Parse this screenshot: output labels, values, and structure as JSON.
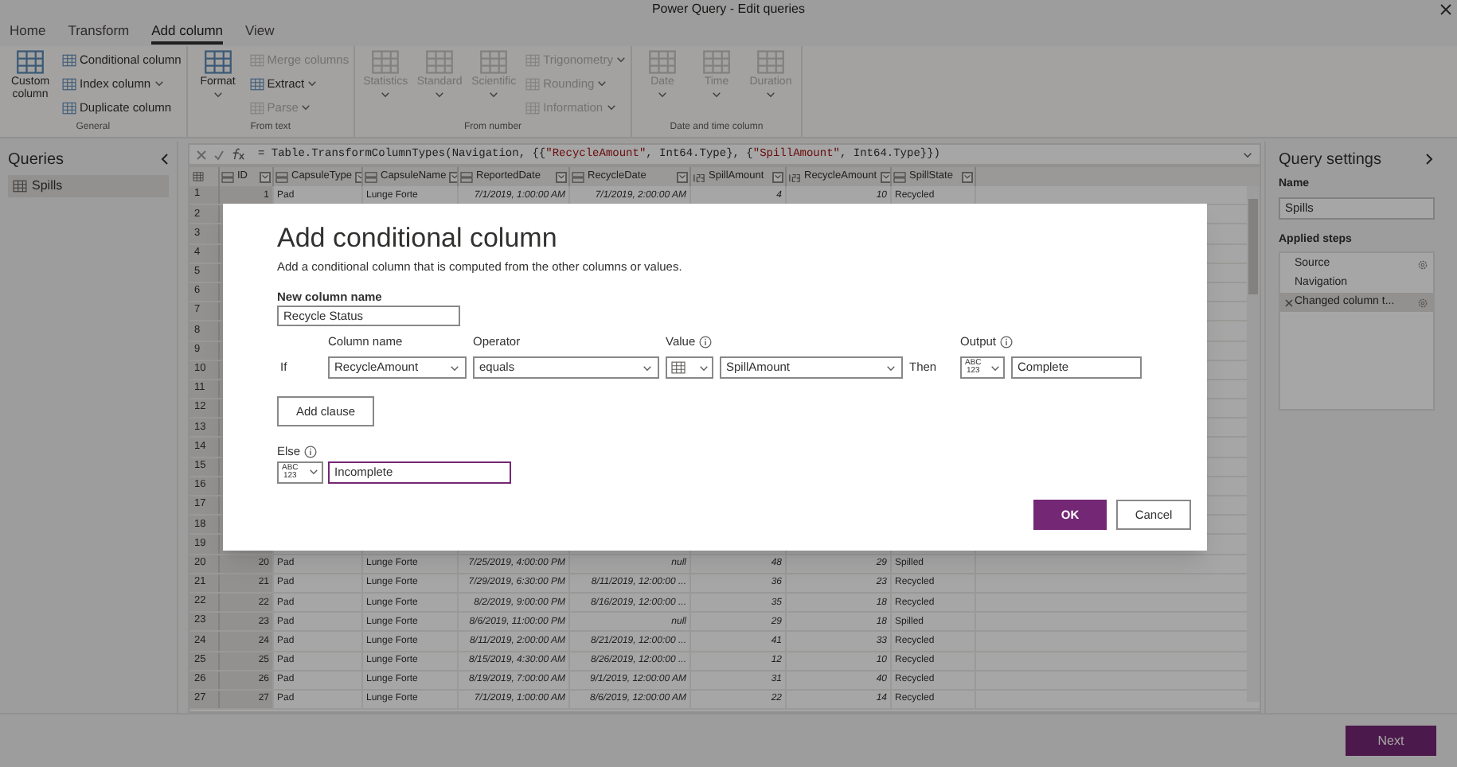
{
  "window": {
    "title": "Power Query - Edit queries"
  },
  "tabs": [
    {
      "label": "Home",
      "selected": false
    },
    {
      "label": "Transform",
      "selected": false
    },
    {
      "label": "Add column",
      "selected": true
    },
    {
      "label": "View",
      "selected": false
    }
  ],
  "ribbon": [
    {
      "label": "General",
      "large": [
        {
          "label": "Custom column",
          "disabled": false,
          "menu": false
        }
      ],
      "small": [
        {
          "label": "Conditional column",
          "disabled": false,
          "menu": false
        },
        {
          "label": "Index column",
          "disabled": false,
          "menu": true
        },
        {
          "label": "Duplicate column",
          "disabled": false,
          "menu": false
        }
      ]
    },
    {
      "label": "From text",
      "large": [
        {
          "label": "Format",
          "disabled": false,
          "menu": true
        }
      ],
      "small": [
        {
          "label": "Merge columns",
          "disabled": true,
          "menu": false
        },
        {
          "label": "Extract",
          "disabled": false,
          "menu": true
        },
        {
          "label": "Parse",
          "disabled": true,
          "menu": true
        }
      ]
    },
    {
      "label": "From number",
      "large": [
        {
          "label": "Statistics",
          "disabled": true,
          "menu": true
        },
        {
          "label": "Standard",
          "disabled": true,
          "menu": true
        },
        {
          "label": "Scientific",
          "disabled": true,
          "menu": true
        }
      ],
      "small": [
        {
          "label": "Trigonometry",
          "disabled": true,
          "menu": true
        },
        {
          "label": "Rounding",
          "disabled": true,
          "menu": true
        },
        {
          "label": "Information",
          "disabled": true,
          "menu": true
        }
      ]
    },
    {
      "label": "Date and time column",
      "large": [
        {
          "label": "Date",
          "disabled": true,
          "menu": true
        },
        {
          "label": "Time",
          "disabled": true,
          "menu": true
        },
        {
          "label": "Duration",
          "disabled": true,
          "menu": true
        }
      ]
    }
  ],
  "queries": {
    "title": "Queries",
    "items": [
      {
        "label": "Spills",
        "selected": true
      }
    ]
  },
  "formula": [
    {
      "kind": "code",
      "text": "= Table.TransformColumnTypes(Navigation, {{"
    },
    {
      "kind": "string",
      "text": "\"RecycleAmount\""
    },
    {
      "kind": "code",
      "text": ", Int64.Type}, {"
    },
    {
      "kind": "string",
      "text": "\"SpillAmount\""
    },
    {
      "kind": "code",
      "text": ", Int64.Type}})"
    }
  ],
  "table": {
    "columns": [
      {
        "label": "ID",
        "kind": "text"
      },
      {
        "label": "CapsuleType",
        "kind": "text"
      },
      {
        "label": "CapsuleName",
        "kind": "text"
      },
      {
        "label": "ReportedDate",
        "kind": "text"
      },
      {
        "label": "RecycleDate",
        "kind": "text"
      },
      {
        "label": "SpillAmount",
        "kind": "number"
      },
      {
        "label": "RecycleAmount",
        "kind": "number"
      },
      {
        "label": "SpillState",
        "kind": "text"
      }
    ],
    "rows": [
      {
        "number": "1",
        "cells": [
          "1",
          "Pad",
          "Lunge Forte",
          "7/1/2019, 1:00:00 AM",
          "7/1/2019, 2:00:00 AM",
          "4",
          "10",
          "Recycled"
        ]
      },
      {
        "number": "2"
      },
      {
        "number": "3"
      },
      {
        "number": "4"
      },
      {
        "number": "5"
      },
      {
        "number": "6"
      },
      {
        "number": "7"
      },
      {
        "number": "8"
      },
      {
        "number": "9"
      },
      {
        "number": "10"
      },
      {
        "number": "11"
      },
      {
        "number": "12"
      },
      {
        "number": "13"
      },
      {
        "number": "14"
      },
      {
        "number": "15"
      },
      {
        "number": "16"
      },
      {
        "number": "17"
      },
      {
        "number": "18"
      },
      {
        "number": "19"
      },
      {
        "number": "20",
        "cells": [
          "20",
          "Pad",
          "Lunge Forte",
          "7/25/2019, 4:00:00 PM",
          "null",
          "48",
          "29",
          "Spilled"
        ]
      },
      {
        "number": "21",
        "cells": [
          "21",
          "Pad",
          "Lunge Forte",
          "7/29/2019, 6:30:00 PM",
          "8/11/2019, 12:00:00 ...",
          "36",
          "23",
          "Recycled"
        ]
      },
      {
        "number": "22",
        "cells": [
          "22",
          "Pad",
          "Lunge Forte",
          "8/2/2019, 9:00:00 PM",
          "8/16/2019, 12:00:00 ...",
          "35",
          "18",
          "Recycled"
        ]
      },
      {
        "number": "23",
        "cells": [
          "23",
          "Pad",
          "Lunge Forte",
          "8/6/2019, 11:00:00 PM",
          "null",
          "29",
          "18",
          "Spilled"
        ]
      },
      {
        "number": "24",
        "cells": [
          "24",
          "Pad",
          "Lunge Forte",
          "8/11/2019, 2:00:00 AM",
          "8/21/2019, 12:00:00 ...",
          "41",
          "33",
          "Recycled"
        ]
      },
      {
        "number": "25",
        "cells": [
          "25",
          "Pad",
          "Lunge Forte",
          "8/15/2019, 4:30:00 AM",
          "8/26/2019, 12:00:00 ...",
          "12",
          "10",
          "Recycled"
        ]
      },
      {
        "number": "26",
        "cells": [
          "26",
          "Pad",
          "Lunge Forte",
          "8/19/2019, 7:00:00 AM",
          "9/1/2019, 12:00:00 AM",
          "31",
          "40",
          "Recycled"
        ]
      },
      {
        "number": "27",
        "cells": [
          "27",
          "Pad",
          "Lunge Forte",
          "7/1/2019, 1:00:00 AM",
          "8/6/2019, 12:00:00 AM",
          "22",
          "14",
          "Recycled"
        ]
      }
    ]
  },
  "settings": {
    "title": "Query settings",
    "name_label": "Name",
    "name_value": "Spills",
    "steps_label": "Applied steps",
    "steps": [
      {
        "label": "Source",
        "selected": false,
        "settings": true,
        "deletable": false
      },
      {
        "label": "Navigation",
        "selected": false,
        "settings": false,
        "deletable": false
      },
      {
        "label": "Changed column t...",
        "selected": true,
        "settings": true,
        "deletable": true
      }
    ]
  },
  "dialog": {
    "title": "Add conditional column",
    "description": "Add a conditional column that is computed from the other columns or values.",
    "name_label": "New column name",
    "name_value": "Recycle Status",
    "headers": {
      "column": "Column name",
      "operator": "Operator",
      "value": "Value",
      "output": "Output"
    },
    "clause": {
      "if": "If",
      "column": "RecycleAmount",
      "operator": "equals",
      "value_type": {
        "kind": "column"
      },
      "value": "SpillAmount",
      "then": "Then",
      "output_type": {
        "kind": "text",
        "label": "ABC\n123"
      },
      "output": "Complete"
    },
    "add_clause": "Add clause",
    "else_label": "Else",
    "else_type": {
      "kind": "text",
      "label": "ABC\n123"
    },
    "else_value": "Incomplete",
    "ok": "OK",
    "cancel": "Cancel"
  },
  "footer": {
    "next": "Next"
  }
}
